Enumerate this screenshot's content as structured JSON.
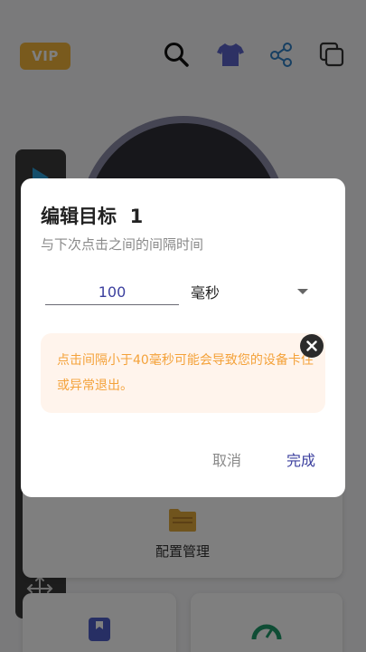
{
  "header": {
    "vip_label": "VIP"
  },
  "icons": {
    "search": "search-icon",
    "shirt": "shirt-icon",
    "share": "share-icon",
    "copy": "copy-icon",
    "play": "play-icon",
    "gear": "gear-icon",
    "move": "move-icon",
    "folder": "folder-icon"
  },
  "cards": {
    "config_label": "配置管理"
  },
  "dialog": {
    "title": "编辑目标  1",
    "subtitle": "与下次点击之间的间隔时间",
    "interval_value": "100",
    "unit": "毫秒",
    "warning": "点击间隔小于40毫秒可能会导致您的设备卡住或异常退出。",
    "cancel_label": "取消",
    "done_label": "完成"
  },
  "colors": {
    "accent": "#3b3f9e",
    "vip": "#f2b43a",
    "warning_text": "#f4a23a",
    "warning_bg": "#fff4ec"
  }
}
